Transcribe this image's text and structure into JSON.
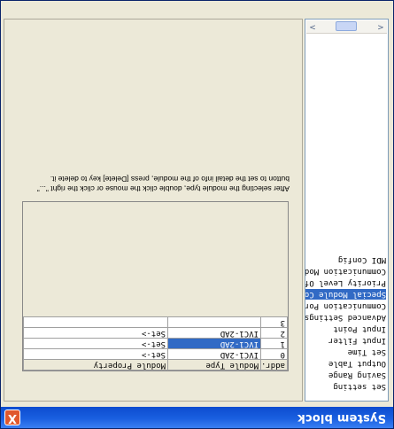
{
  "window": {
    "title": "System block",
    "close_glyph": "X",
    "title_color": "#ffffff",
    "titlebar_color": "#0c4ccf"
  },
  "sidebar": {
    "items": [
      {
        "label": "Set setting",
        "selected": false
      },
      {
        "label": "Saving Range",
        "selected": false
      },
      {
        "label": "Output Table",
        "selected": false
      },
      {
        "label": "Set Time",
        "selected": false
      },
      {
        "label": "Input Filter",
        "selected": false
      },
      {
        "label": "Input Point",
        "selected": false
      },
      {
        "label": "Advanced Settings",
        "selected": false
      },
      {
        "label": "Communication Port",
        "selected": false
      },
      {
        "label": "Special Module Configu",
        "selected": true
      },
      {
        "label": "Priority Level Of Inte",
        "selected": false
      },
      {
        "label": "Communication Modules",
        "selected": false
      },
      {
        "label": "MDI Config",
        "selected": false
      }
    ],
    "scroll_left_glyph": "<",
    "scroll_right_glyph": ">",
    "scroll_thumb_glyph": "III"
  },
  "modules": {
    "headers": {
      "addr": "addr.",
      "type": "Module Type",
      "property": "Module Property"
    },
    "rows": [
      {
        "addr": "0",
        "type": "IVC1-2AD",
        "property": "Set->",
        "selected": false
      },
      {
        "addr": "1",
        "type": "IVC1-2AD",
        "property": "Set->",
        "selected": true
      },
      {
        "addr": "2",
        "type": "IVC1-2AD",
        "property": "Set->",
        "selected": false
      },
      {
        "addr": "3",
        "type": "",
        "property": "",
        "selected": false
      }
    ]
  },
  "hint": {
    "line1": "After selecting the module type, double click the mouse or click the right \"...\"",
    "line2": "button to set the detail info of the module, press [Delete] key to delete it."
  },
  "colors": {
    "selection": "#316ac5",
    "background": "#ece9d8"
  }
}
